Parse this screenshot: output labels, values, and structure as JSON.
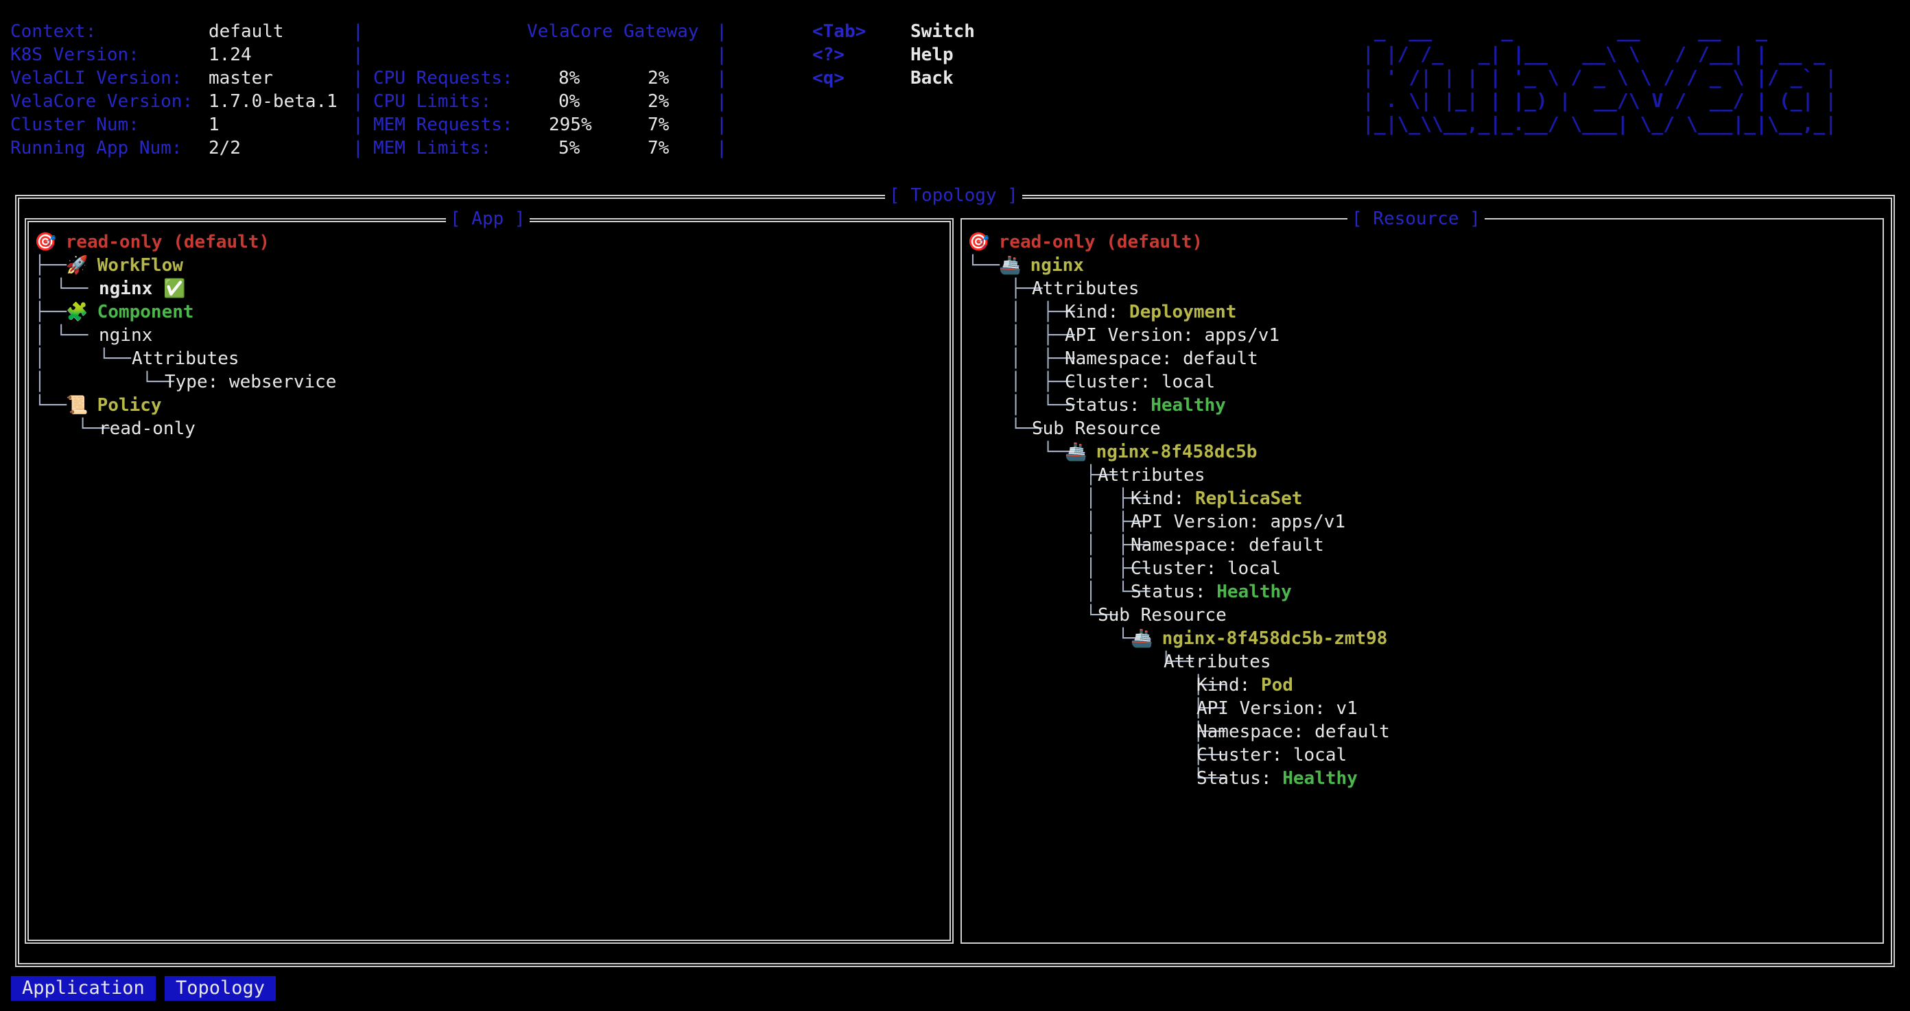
{
  "info": {
    "rows": [
      {
        "label": "Context:",
        "value": "default"
      },
      {
        "label": "K8S Version:",
        "value": "1.24"
      },
      {
        "label": "VelaCLI Version:",
        "value": "master"
      },
      {
        "label": "VelaCore Version:",
        "value": "1.7.0-beta.1"
      },
      {
        "label": "Cluster Num:",
        "value": "1"
      },
      {
        "label": "Running App Num:",
        "value": "2/2"
      }
    ],
    "gateway_title": "VelaCore Gateway",
    "resources": [
      {
        "label": "CPU Requests:",
        "v1": "8%",
        "v2": "2%"
      },
      {
        "label": "CPU Limits:",
        "v1": "0%",
        "v2": "2%"
      },
      {
        "label": "MEM Requests:",
        "v1": "295%",
        "v2": "7%"
      },
      {
        "label": "MEM Limits:",
        "v1": "5%",
        "v2": "7%"
      }
    ]
  },
  "shortcuts": [
    {
      "key": "<Tab>",
      "action": "Switch"
    },
    {
      "key": "<?>",
      "action": "Help"
    },
    {
      "key": "<q>",
      "action": "Back"
    }
  ],
  "logo": {
    "lines": [
      " _  __      _         __     __   _        ",
      "| |/ /_   _| |__   __\\ \\   / /__| | __ _ ",
      "| ' /| | | | '_ \\ / _ \\ \\ / / _ \\ |/ _` |",
      "| . \\| |_| | |_) |  __/\\ V /  __/ | (_| |",
      "|_|\\_\\\\__,_|_.__/ \\___| \\_/ \\___|_|\\__,_|"
    ]
  },
  "topology": {
    "title": "[ Topology ]",
    "app_panel_title": "[ App ]",
    "resource_panel_title": "[ Resource ]",
    "app_tree": {
      "root": "read-only (default)",
      "workflow_label": "WorkFlow",
      "workflow_step": "nginx",
      "component_label": "Component",
      "component_name": "nginx",
      "attributes": "Attributes",
      "type_line": "Type: webservice",
      "policy_label": "Policy",
      "policy_name": "read-only"
    },
    "resource_tree": {
      "root": "read-only (default)",
      "attributes": "Attributes",
      "sub_resource": "Sub Resource",
      "kind_prefix": "Kind: ",
      "api_prefix": "API Version: ",
      "ns_line": "Namespace: default",
      "cluster_line": "Cluster: local",
      "status_prefix": "Status: ",
      "nodes": [
        {
          "name": "nginx",
          "kind": "Deployment",
          "api": "apps/v1",
          "status": "Healthy"
        },
        {
          "name": "nginx-8f458dc5b",
          "kind": "ReplicaSet",
          "api": "apps/v1",
          "status": "Healthy"
        },
        {
          "name": "nginx-8f458dc5b-zmt98",
          "kind": "Pod",
          "api": "v1",
          "status": "Healthy"
        }
      ]
    }
  },
  "bottom_tabs": [
    {
      "label": "Application"
    },
    {
      "label": "Topology"
    }
  ],
  "colors": {
    "accent_blue": "#2727c8",
    "red": "#c83a32",
    "yellow": "#b8b84a",
    "green": "#4cb84c"
  }
}
